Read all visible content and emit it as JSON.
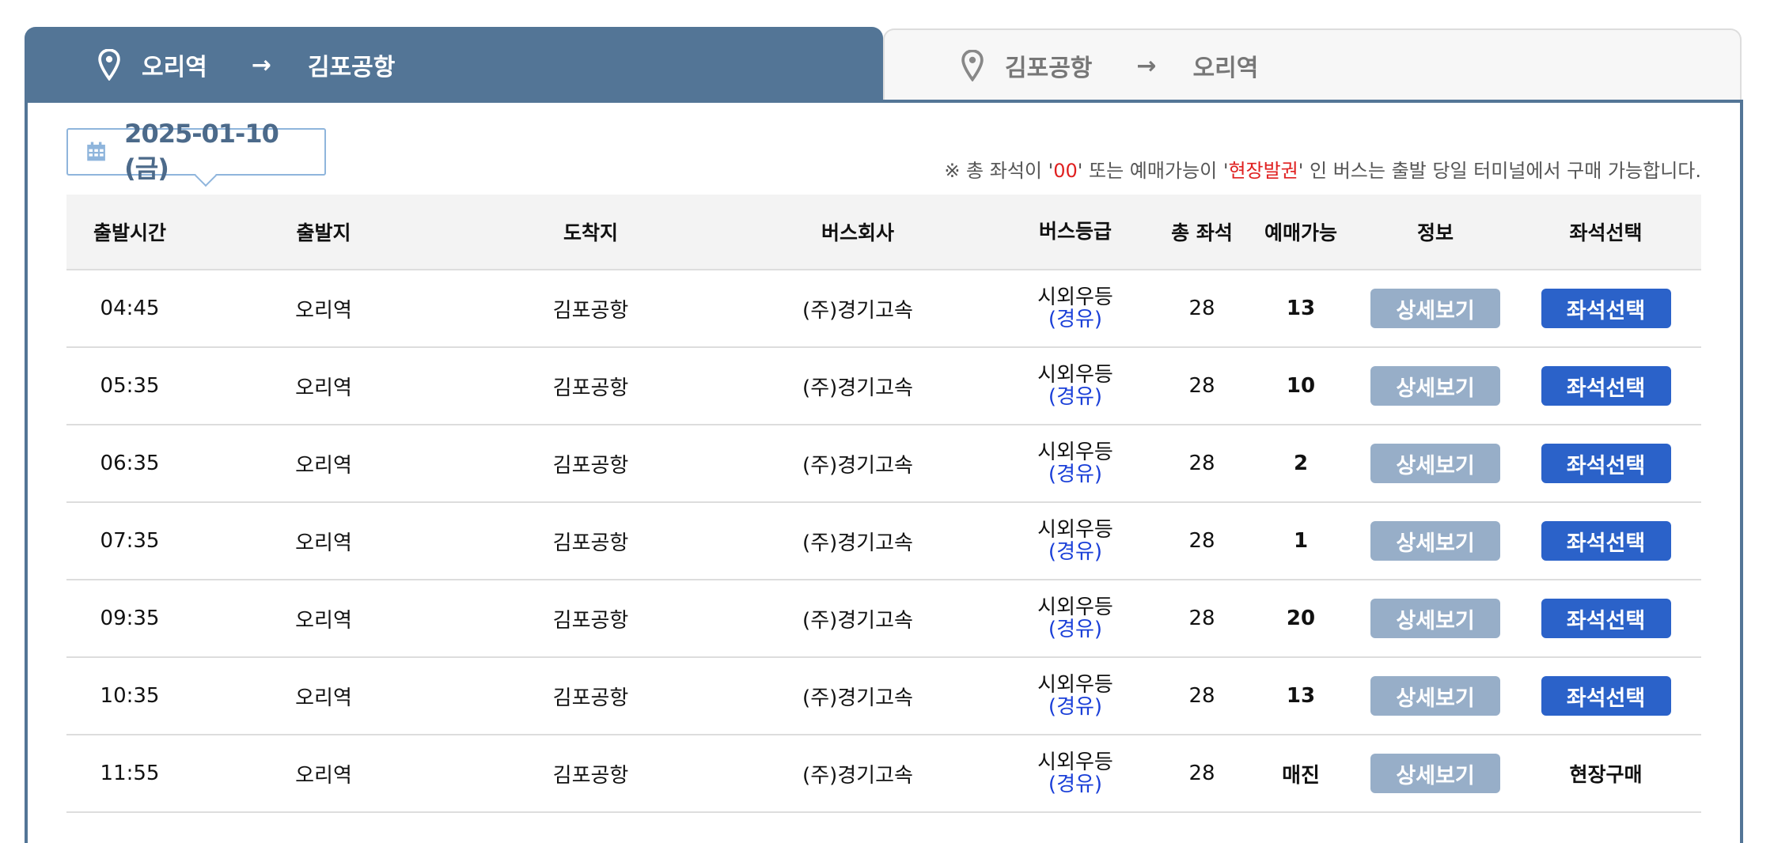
{
  "tabs": [
    {
      "from": "오리역",
      "to": "김포공항",
      "active": true
    },
    {
      "from": "김포공항",
      "to": "오리역",
      "active": false
    }
  ],
  "arrow_glyph": "→",
  "date": "2025-01-10 (금)",
  "notice": {
    "prefix": "※ 총 좌석이 '",
    "red1": "00",
    "mid": "' 또는 예매가능이 '",
    "red2": "현장발권",
    "suffix": "' 인 버스는 출발 당일 터미널에서 구매 가능합니다."
  },
  "columns": [
    "출발시간",
    "출발지",
    "도착지",
    "버스회사",
    "버스등급",
    "총 좌석",
    "예매가능",
    "정보",
    "좌석선택"
  ],
  "rows": [
    {
      "time": "04:45",
      "dep": "오리역",
      "arr": "김포공항",
      "company": "(주)경기고속",
      "grade": "시외우등",
      "grade_sub": "(경유)",
      "total": "28",
      "avail": "13",
      "info": "상세보기",
      "seat": "좌석선택"
    },
    {
      "time": "05:35",
      "dep": "오리역",
      "arr": "김포공항",
      "company": "(주)경기고속",
      "grade": "시외우등",
      "grade_sub": "(경유)",
      "total": "28",
      "avail": "10",
      "info": "상세보기",
      "seat": "좌석선택"
    },
    {
      "time": "06:35",
      "dep": "오리역",
      "arr": "김포공항",
      "company": "(주)경기고속",
      "grade": "시외우등",
      "grade_sub": "(경유)",
      "total": "28",
      "avail": "2",
      "info": "상세보기",
      "seat": "좌석선택"
    },
    {
      "time": "07:35",
      "dep": "오리역",
      "arr": "김포공항",
      "company": "(주)경기고속",
      "grade": "시외우등",
      "grade_sub": "(경유)",
      "total": "28",
      "avail": "1",
      "info": "상세보기",
      "seat": "좌석선택"
    },
    {
      "time": "09:35",
      "dep": "오리역",
      "arr": "김포공항",
      "company": "(주)경기고속",
      "grade": "시외우등",
      "grade_sub": "(경유)",
      "total": "28",
      "avail": "20",
      "info": "상세보기",
      "seat": "좌석선택"
    },
    {
      "time": "10:35",
      "dep": "오리역",
      "arr": "김포공항",
      "company": "(주)경기고속",
      "grade": "시외우등",
      "grade_sub": "(경유)",
      "total": "28",
      "avail": "13",
      "info": "상세보기",
      "seat": "좌석선택"
    },
    {
      "time": "11:55",
      "dep": "오리역",
      "arr": "김포공항",
      "company": "(주)경기고속",
      "grade": "시외우등",
      "grade_sub": "(경유)",
      "total": "28",
      "avail": "매진",
      "info": "상세보기",
      "seat": "현장구매"
    }
  ]
}
